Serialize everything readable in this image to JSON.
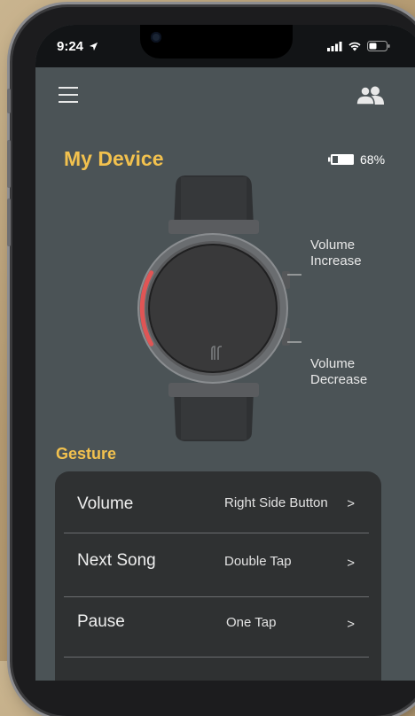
{
  "status_bar": {
    "time": "9:24",
    "location_icon": "location-arrow-icon",
    "signal_icon": "cellular-signal-icon",
    "wifi_icon": "wifi-icon",
    "battery_icon": "battery-icon"
  },
  "app_bar": {
    "menu_icon": "hamburger-menu-icon",
    "contacts_icon": "people-icon"
  },
  "device": {
    "title": "My Device",
    "battery_percent": "68%",
    "battery_level": 0.68
  },
  "watch": {
    "upper_button_label_line1": "Volume",
    "upper_button_label_line2": "Increase",
    "lower_button_label_line1": "Volume",
    "lower_button_label_line2": "Decrease"
  },
  "gesture": {
    "title": "Gesture",
    "rows": [
      {
        "label": "Volume",
        "value": "Right Side Button",
        "arrow": ">"
      },
      {
        "label": "Next Song",
        "value": "Double Tap",
        "arrow": ">"
      },
      {
        "label": "Pause",
        "value": "One Tap",
        "arrow": ">"
      }
    ]
  },
  "colors": {
    "accent": "#f2c14e",
    "screen_background": "#4b5356",
    "card_background": "#2f3132",
    "bezel_highlight": "#e05555"
  }
}
